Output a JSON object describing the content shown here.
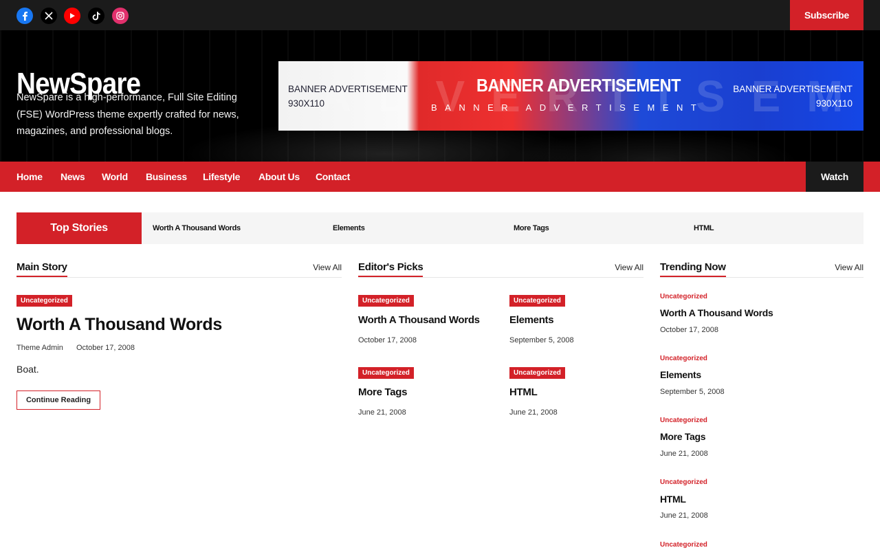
{
  "topbar": {
    "social": [
      {
        "icon": "facebook-icon",
        "color": "#1877f2"
      },
      {
        "icon": "x-icon",
        "color": "#000000"
      },
      {
        "icon": "youtube-icon",
        "color": "#ff0000"
      },
      {
        "icon": "tiktok-icon",
        "color": "#000000"
      },
      {
        "icon": "instagram-icon",
        "color": "#e1306c"
      }
    ],
    "subscribe_label": "Subscribe"
  },
  "header": {
    "site_title": "NewSpare",
    "tagline": "NewSpare is a high-performance, Full Site Editing (FSE) WordPress theme expertly crafted for news, magazines, and professional blogs.",
    "banner": {
      "left_line1": "BANNER ADVERTISEMENT",
      "left_line2": "930X110",
      "main": "BANNER ADVERTISEMENT",
      "sub": "BANNER ADVERTISEMENT",
      "right_line1": "BANNER ADVERTISEMENT",
      "right_line2": "930X110",
      "ghost": "ADVERTISEMENT"
    }
  },
  "nav": {
    "items": [
      "Home",
      "News",
      "World",
      "Business",
      "Lifestyle",
      "About Us",
      "Contact"
    ],
    "watch_label": "Watch"
  },
  "ticker": {
    "label": "Top Stories",
    "items": [
      "Worth A Thousand Words",
      "Elements",
      "More Tags",
      "HTML"
    ]
  },
  "main_story": {
    "section_title": "Main Story",
    "view_all": "View All",
    "category": "Uncategorized",
    "title": "Worth A Thousand Words",
    "author": "Theme Admin",
    "date": "October 17, 2008",
    "excerpt": "Boat.",
    "button": "Continue Reading"
  },
  "editors_picks": {
    "section_title": "Editor's Picks",
    "view_all": "View All",
    "posts": [
      {
        "category": "Uncategorized",
        "title": "Worth A Thousand Words",
        "date": "October 17, 2008"
      },
      {
        "category": "Uncategorized",
        "title": "Elements",
        "date": "September 5, 2008"
      },
      {
        "category": "Uncategorized",
        "title": "More Tags",
        "date": "June 21, 2008"
      },
      {
        "category": "Uncategorized",
        "title": "HTML",
        "date": "June 21, 2008"
      }
    ]
  },
  "trending": {
    "section_title": "Trending Now",
    "view_all": "View All",
    "posts": [
      {
        "category": "Uncategorized",
        "title": "Worth A Thousand Words",
        "date": "October 17, 2008"
      },
      {
        "category": "Uncategorized",
        "title": "Elements",
        "date": "September 5, 2008"
      },
      {
        "category": "Uncategorized",
        "title": "More Tags",
        "date": "June 21, 2008"
      },
      {
        "category": "Uncategorized",
        "title": "HTML",
        "date": "June 21, 2008"
      },
      {
        "category": "Uncategorized"
      }
    ]
  },
  "colors": {
    "accent": "#d32128",
    "dark": "#1b1b1b"
  }
}
